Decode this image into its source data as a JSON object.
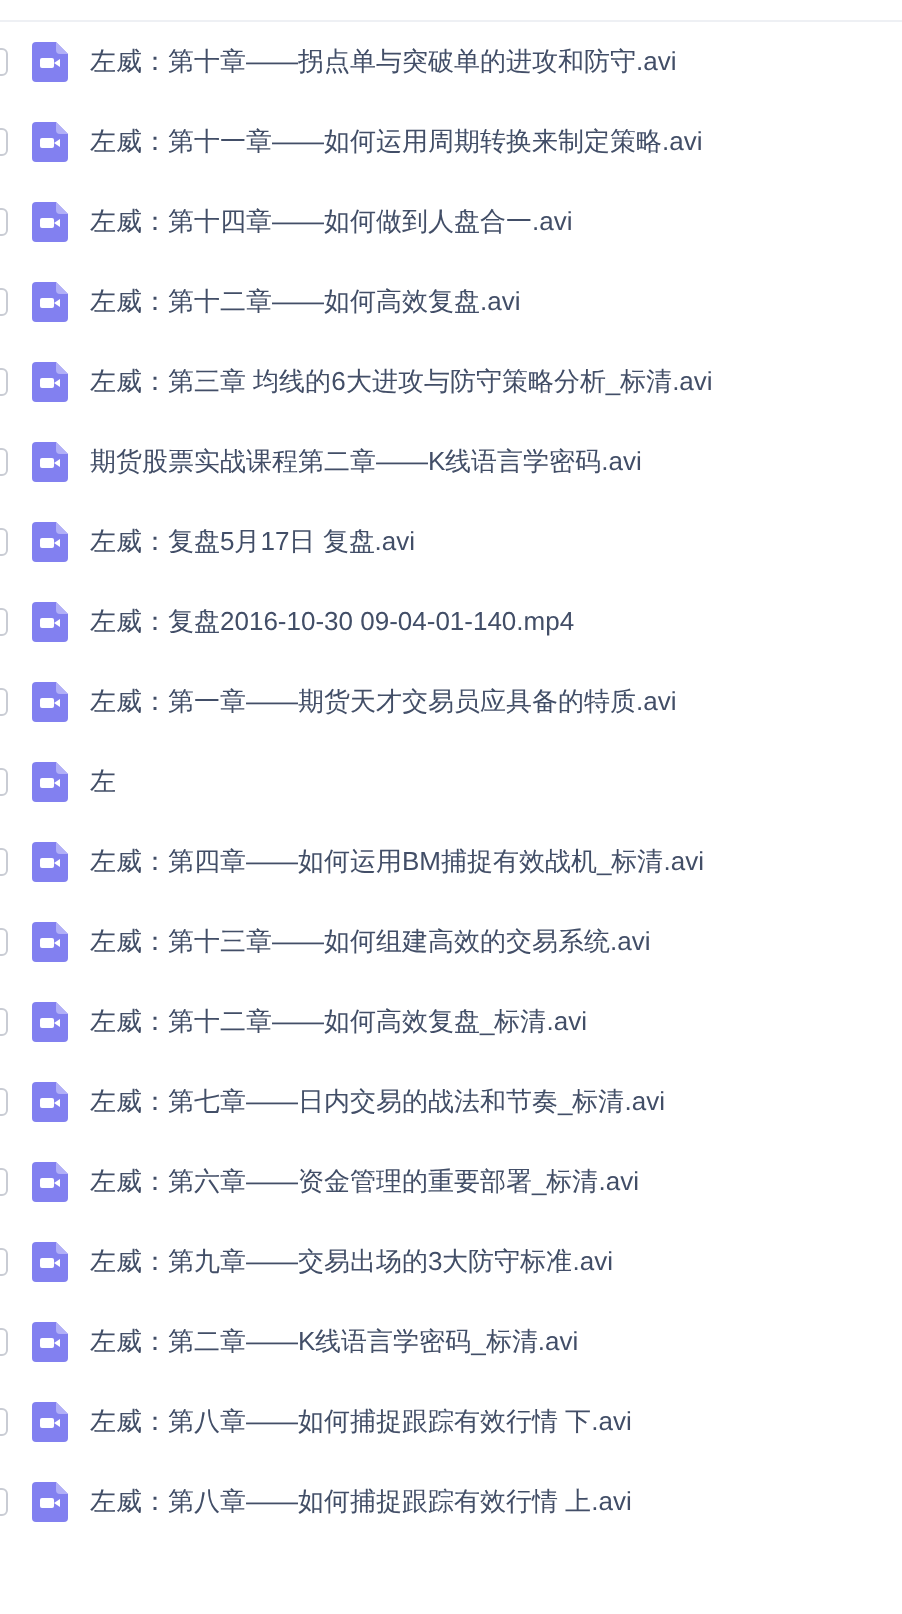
{
  "files": [
    {
      "name": "左威：第十章——拐点单与突破单的进攻和防守.avi",
      "checked": false
    },
    {
      "name": "左威：第十一章——如何运用周期转换来制定策略.avi",
      "checked": false
    },
    {
      "name": "左威：第十四章——如何做到人盘合一.avi",
      "checked": false
    },
    {
      "name": "左威：第十二章——如何高效复盘.avi",
      "checked": false
    },
    {
      "name": "左威：第三章 均线的6大进攻与防守策略分析_标清.avi",
      "checked": false
    },
    {
      "name": "期货股票实战课程第二章——K线语言学密码.avi",
      "checked": false
    },
    {
      "name": "左威：复盘5月17日 复盘.avi",
      "checked": false
    },
    {
      "name": "左威：复盘2016-10-30 09-04-01-140.mp4",
      "checked": false
    },
    {
      "name": "左威：第一章——期货天才交易员应具备的特质.avi",
      "checked": false
    },
    {
      "name": "左",
      "checked": false
    },
    {
      "name": "左威：第四章——如何运用BM捕捉有效战机_标清.avi",
      "checked": false
    },
    {
      "name": "左威：第十三章——如何组建高效的交易系统.avi",
      "checked": false
    },
    {
      "name": "左威：第十二章——如何高效复盘_标清.avi",
      "checked": false
    },
    {
      "name": "左威：第七章——日内交易的战法和节奏_标清.avi",
      "checked": false
    },
    {
      "name": "左威：第六章——资金管理的重要部署_标清.avi",
      "checked": false
    },
    {
      "name": "左威：第九章——交易出场的3大防守标准.avi",
      "checked": false
    },
    {
      "name": "左威：第二章——K线语言学密码_标清.avi",
      "checked": false
    },
    {
      "name": "左威：第八章——如何捕捉跟踪有效行情 下.avi",
      "checked": false
    },
    {
      "name": "左威：第八章——如何捕捉跟踪有效行情  上.avi",
      "checked": false
    }
  ]
}
